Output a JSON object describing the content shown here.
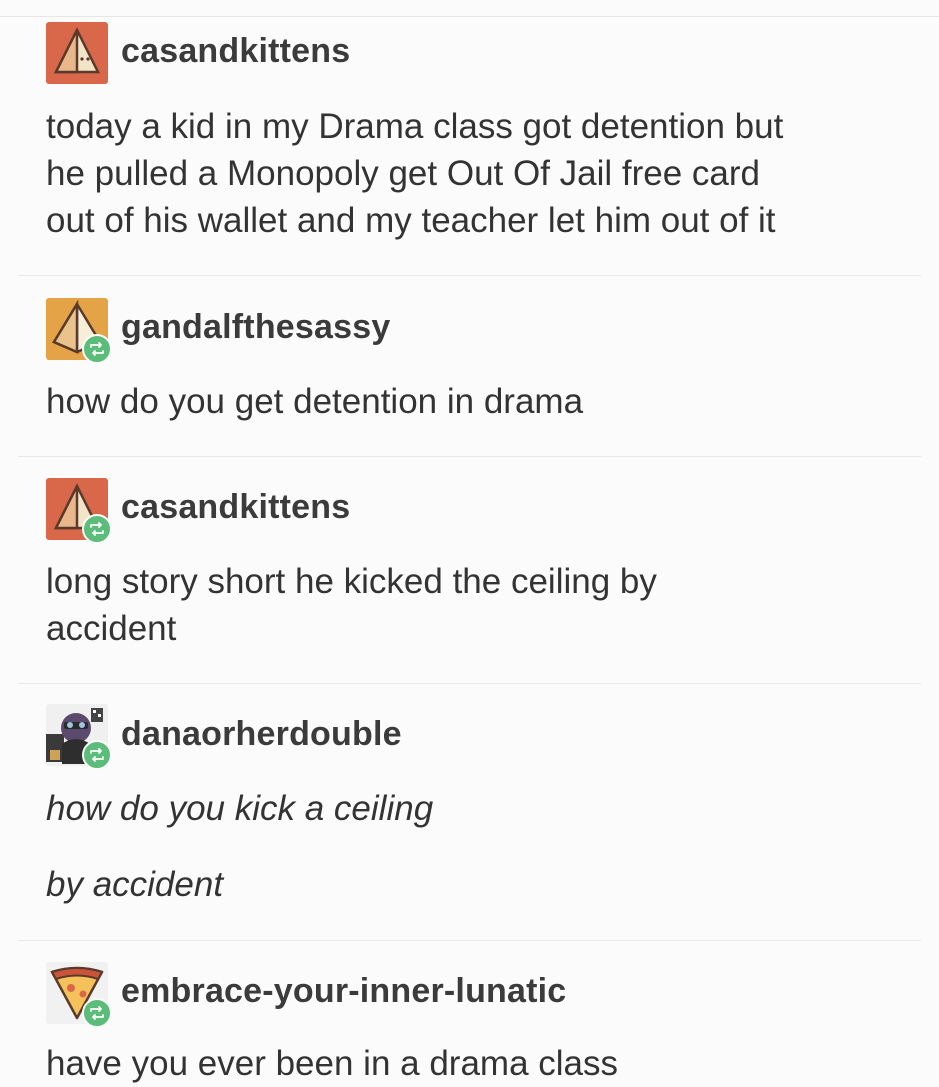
{
  "posts": [
    {
      "username": "casandkittens",
      "avatar_icon": "orange-pyramid-avatar-icon",
      "reblog": false,
      "lines": [
        "today a kid in my Drama class got detention but",
        "he pulled a Monopoly get Out Of Jail free card",
        "out of his wallet and my teacher let him out of it"
      ]
    },
    {
      "username": "gandalfthesassy",
      "avatar_icon": "yellow-pyramid-avatar-icon",
      "reblog": true,
      "lines": [
        "how do you get detention in drama"
      ]
    },
    {
      "username": "casandkittens",
      "avatar_icon": "orange-pyramid-avatar-icon",
      "reblog": true,
      "lines": [
        "long story short he kicked the ceiling by",
        "accident"
      ]
    },
    {
      "username": "danaorherdouble",
      "avatar_icon": "character-photo-avatar-icon",
      "reblog": true,
      "italic": true,
      "lines": [
        "how do you kick a ceiling",
        "by accident"
      ]
    },
    {
      "username": "embrace-your-inner-lunatic",
      "avatar_icon": "pizza-slice-avatar-icon",
      "reblog": true,
      "lines": [
        "have you ever been in a drama class"
      ]
    }
  ],
  "colors": {
    "reblog_badge": "#5cbd7a",
    "divider": "#e9e9e9",
    "background": "#fbfbfb"
  }
}
